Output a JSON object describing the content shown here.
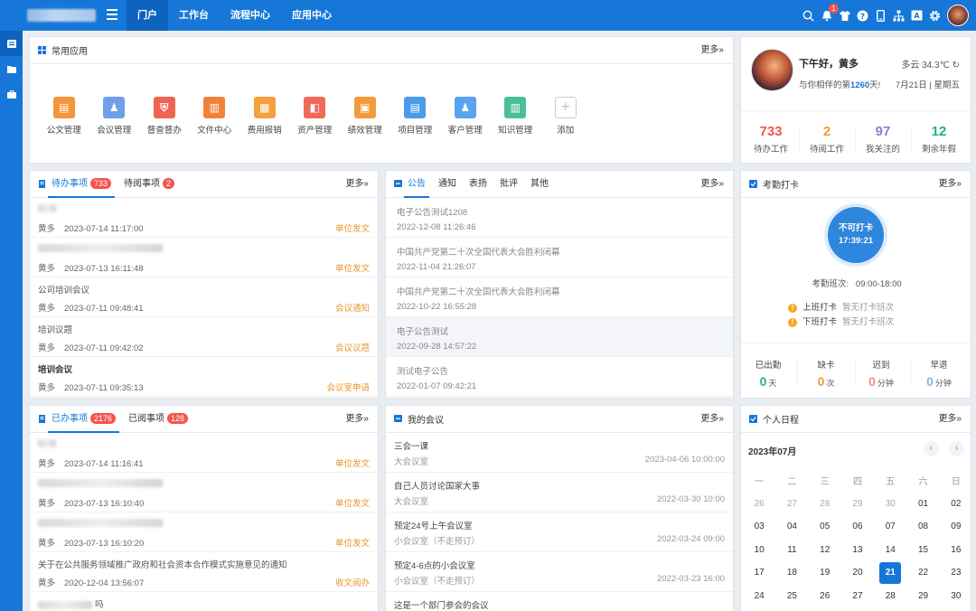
{
  "header": {
    "nav": [
      {
        "label": "门户",
        "active": true
      },
      {
        "label": "工作台",
        "active": false
      },
      {
        "label": "流程中心",
        "active": false
      },
      {
        "label": "应用中心",
        "active": false
      }
    ],
    "notification_badge": "1",
    "icons": [
      "search-icon",
      "bell-icon",
      "shirt-icon",
      "help-icon",
      "mobile-icon",
      "org-icon",
      "translate-icon",
      "settings-icon"
    ]
  },
  "sidebar": {
    "icons": [
      "portal-icon",
      "folder-icon",
      "briefcase-icon"
    ]
  },
  "apps": {
    "title": "常用应用",
    "more": "更多»",
    "items": [
      {
        "label": "公文管理",
        "color": "#f6963a",
        "glyph": "▤"
      },
      {
        "label": "会议管理",
        "color": "#6fa0e8",
        "glyph": "♟"
      },
      {
        "label": "督查督办",
        "color": "#ef6452",
        "glyph": "⛨"
      },
      {
        "label": "文件中心",
        "color": "#f2823a",
        "glyph": "▥"
      },
      {
        "label": "费用报销",
        "color": "#f5a03e",
        "glyph": "▦"
      },
      {
        "label": "资产管理",
        "color": "#f06a5a",
        "glyph": "◧"
      },
      {
        "label": "绩效管理",
        "color": "#f59a3c",
        "glyph": "▣"
      },
      {
        "label": "项目管理",
        "color": "#4a9be8",
        "glyph": "▤"
      },
      {
        "label": "客户管理",
        "color": "#5aa3ee",
        "glyph": "♟"
      },
      {
        "label": "知识管理",
        "color": "#4cbf9a",
        "glyph": "▥"
      },
      {
        "label": "添加",
        "color": "",
        "glyph": "+"
      }
    ]
  },
  "profile": {
    "greeting": "下午好，黄多",
    "weather": "多云 34.3℃",
    "days_prefix": "与你相伴的第",
    "days": "1260",
    "days_suffix": "天!",
    "date": "7月21日 | 星期五",
    "stats": [
      {
        "value": "733",
        "label": "待办工作",
        "color": "#f5544d"
      },
      {
        "value": "2",
        "label": "待阅工作",
        "color": "#f59a2e"
      },
      {
        "value": "97",
        "label": "我关注的",
        "color": "#8b80d8"
      },
      {
        "value": "12",
        "label": "剩余年假",
        "color": "#25b37a"
      }
    ]
  },
  "todo": {
    "tabs": [
      {
        "label": "待办事项",
        "count": "733"
      },
      {
        "label": "待阅事项",
        "count": "2"
      }
    ],
    "more": "更多»",
    "rows": [
      {
        "title": "",
        "user": "黄多",
        "time": "2023-07-14 11:17:00",
        "tag": "单位发文",
        "blur": true
      },
      {
        "title": "",
        "user": "黄多",
        "time": "2023-07-13 16:11:48",
        "tag": "单位发文",
        "blur": true
      },
      {
        "title": "公司培训会议",
        "user": "黄多",
        "time": "2023-07-11 09:48:41",
        "tag": "会议通知",
        "blur": false
      },
      {
        "title": "培训议题",
        "user": "黄多",
        "time": "2023-07-11 09:42:02",
        "tag": "会议议题",
        "blur": false
      },
      {
        "title": "培训会议",
        "user": "黄多",
        "time": "2023-07-11 09:35:13",
        "tag": "会议室申请",
        "blur": false,
        "bold": true
      }
    ]
  },
  "notice": {
    "title": "公告",
    "tabs": [
      "公告",
      "通知",
      "表扬",
      "批评",
      "其他"
    ],
    "more": "更多»",
    "rows": [
      {
        "title": "电子公告测试1208",
        "time": "2022-12-08 11:26:46"
      },
      {
        "title": "中国共产党第二十次全国代表大会胜利闭幕",
        "time": "2022-11-04 21:26:07"
      },
      {
        "title": "中国共产党第二十次全国代表大会胜利闭幕",
        "time": "2022-10-22 16:55:28"
      },
      {
        "title": "电子公告测试",
        "time": "2022-09-28 14:57:22"
      },
      {
        "title": "测试电子公告",
        "time": "2022-01-07 09:42:21"
      }
    ]
  },
  "attendance": {
    "title": "考勤打卡",
    "more": "更多»",
    "button_label": "不可打卡",
    "button_time": "17:39:21",
    "shift_label": "考勤班次:",
    "shift_time": "09:00-18:00",
    "records": [
      {
        "label": "上班打卡",
        "status": "暂无打卡班次"
      },
      {
        "label": "下班打卡",
        "status": "暂无打卡班次"
      }
    ],
    "stats": [
      {
        "label": "已出勤",
        "value": "0",
        "unit": "天",
        "color": "#25b37a"
      },
      {
        "label": "缺卡",
        "value": "0",
        "unit": "次",
        "color": "#f59a2e"
      },
      {
        "label": "迟到",
        "value": "0",
        "unit": "分钟",
        "color": "#f5898a"
      },
      {
        "label": "早退",
        "value": "0",
        "unit": "分钟",
        "color": "#8ab4e8"
      }
    ]
  },
  "done": {
    "tabs": [
      {
        "label": "已办事项",
        "count": "2176"
      },
      {
        "label": "已阅事项",
        "count": "128"
      }
    ],
    "more": "更多»",
    "rows": [
      {
        "title": "",
        "user": "黄多",
        "time": "2023-07-14 11:16:41",
        "tag": "单位发文",
        "blur": true
      },
      {
        "title": "",
        "user": "黄多",
        "time": "2023-07-13 16:10:40",
        "tag": "单位发文",
        "blur": true
      },
      {
        "title": "",
        "user": "黄多",
        "time": "2023-07-13 16:10:20",
        "tag": "单位发文",
        "blur": true
      },
      {
        "title": "关于在公共服务领域推广政府和社会资本合作模式实施意见的通知",
        "user": "黄多",
        "time": "2020-12-04 13:56:07",
        "tag": "收文阅办",
        "blur": false
      },
      {
        "title": "",
        "user": "",
        "time": "",
        "tag": "",
        "blur": true,
        "suffix": "吗"
      }
    ]
  },
  "meetings": {
    "title": "我的会议",
    "more": "更多»",
    "rows": [
      {
        "title": "三会一课",
        "room": "大会议室",
        "time": "2023-04-06 10:00:00"
      },
      {
        "title": "自己人员讨论国家大事",
        "room": "大会议室",
        "time": "2022-03-30 10:00"
      },
      {
        "title": "预定24号上午会议室",
        "room": "小会议室（不走预订）",
        "time": "2022-03-24 09:00"
      },
      {
        "title": "预定4-6点的小会议室",
        "room": "小会议室（不走预订）",
        "time": "2022-03-23 16:00"
      },
      {
        "title": "这是一个部门参会的会议",
        "room": "",
        "time": ""
      }
    ]
  },
  "calendar": {
    "title": "个人日程",
    "more": "更多»",
    "month": "2023年07月",
    "weekdays": [
      "一",
      "二",
      "三",
      "四",
      "五",
      "六",
      "日"
    ],
    "weeks": [
      [
        "26",
        "27",
        "28",
        "29",
        "30",
        "01",
        "02"
      ],
      [
        "03",
        "04",
        "05",
        "06",
        "07",
        "08",
        "09"
      ],
      [
        "10",
        "11",
        "12",
        "13",
        "14",
        "15",
        "16"
      ],
      [
        "17",
        "18",
        "19",
        "20",
        "21",
        "22",
        "23"
      ],
      [
        "24",
        "25",
        "26",
        "27",
        "28",
        "29",
        "30"
      ]
    ],
    "today": "21"
  }
}
